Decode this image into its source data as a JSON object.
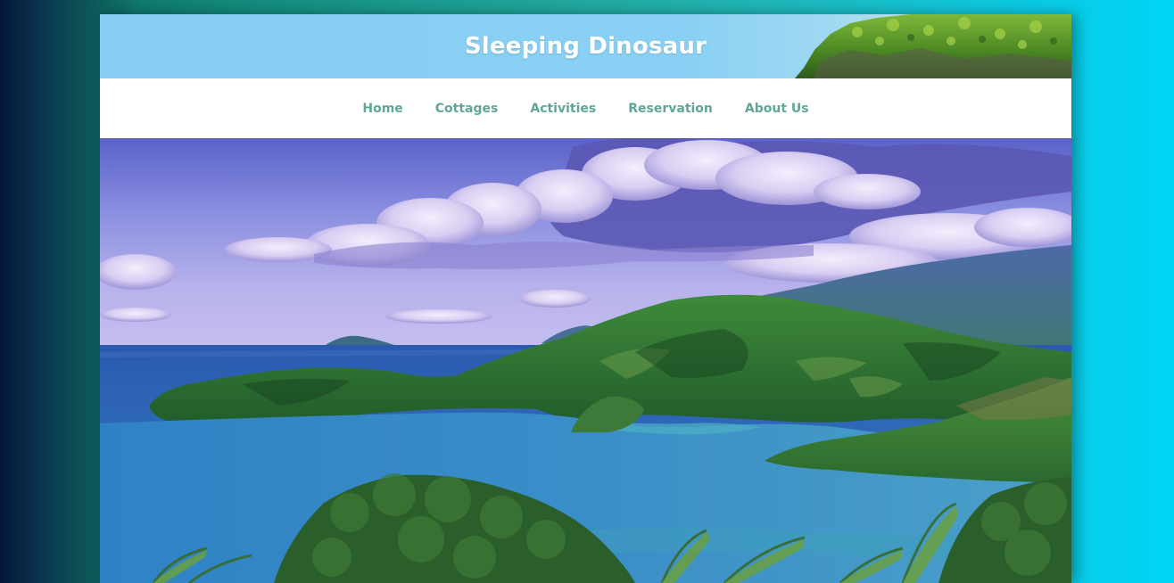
{
  "site": {
    "title": "Sleeping Dinosaur"
  },
  "nav": {
    "items": [
      {
        "label": "Home"
      },
      {
        "label": "Cottages"
      },
      {
        "label": "Activities"
      },
      {
        "label": "Reservation"
      },
      {
        "label": "About Us"
      }
    ]
  },
  "colors": {
    "nav_link": "#5fa69a",
    "banner_sky": "#86cdf2",
    "title_text": "#ffffff"
  },
  "hero": {
    "image_subject": "bay-landscape-photo"
  }
}
